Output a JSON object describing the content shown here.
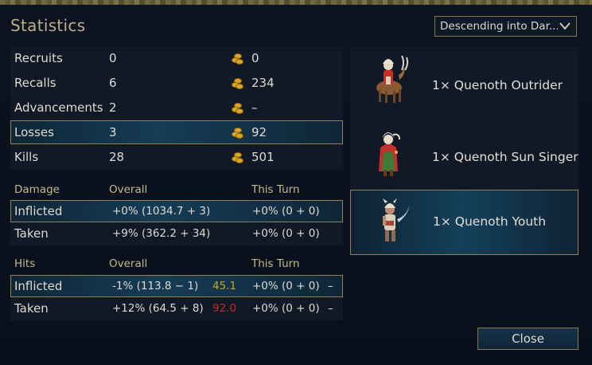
{
  "title": "Statistics",
  "scenario_select": {
    "value": "Descending into Dar..."
  },
  "summary": {
    "rows": [
      {
        "label": "Recruits",
        "count": "0",
        "gold": "0"
      },
      {
        "label": "Recalls",
        "count": "6",
        "gold": "234"
      },
      {
        "label": "Advancements",
        "count": "2",
        "gold": "–"
      },
      {
        "label": "Losses",
        "count": "3",
        "gold": "92"
      },
      {
        "label": "Kills",
        "count": "28",
        "gold": "501"
      }
    ],
    "highlighted_row": "Losses"
  },
  "damage": {
    "header": {
      "label": "Damage",
      "overall": "Overall",
      "this_turn": "This Turn"
    },
    "rows": [
      {
        "label": "Inflicted",
        "overall": "+0% (1034.7 + 3)",
        "this_turn": "+0% (0 + 0)"
      },
      {
        "label": "Taken",
        "overall": "+9% (362.2 + 34)",
        "this_turn": "+0% (0 + 0)"
      }
    ]
  },
  "hits": {
    "header": {
      "label": "Hits",
      "overall": "Overall",
      "this_turn": "This Turn"
    },
    "rows": [
      {
        "label": "Inflicted",
        "overall": "-1% (113.8 − 1)",
        "pct": "45.1",
        "pct_color": "#c8a52a",
        "this_turn": "+0% (0 + 0)",
        "dash": "–"
      },
      {
        "label": "Taken",
        "overall": "+12% (64.5 + 8)",
        "pct": "92.0",
        "pct_color": "#c32a1e",
        "this_turn": "+0% (0 + 0)",
        "dash": "–"
      }
    ]
  },
  "units": [
    {
      "label": "1× Quenoth Outrider",
      "icon": "quenoth-outrider-sprite"
    },
    {
      "label": "1× Quenoth Sun Singer",
      "icon": "quenoth-sun-singer-sprite"
    },
    {
      "label": "1× Quenoth Youth",
      "icon": "quenoth-youth-sprite"
    }
  ],
  "selected_unit": "1× Quenoth Youth",
  "close_label": "Close",
  "colors": {
    "accent_border": "#8f8354",
    "title": "#bcb088",
    "header": "#c5b98c"
  }
}
